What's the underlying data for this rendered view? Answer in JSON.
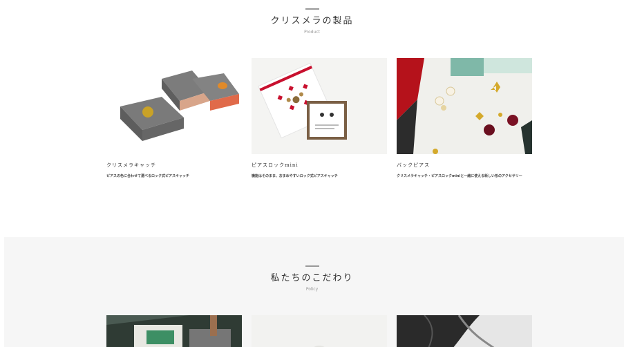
{
  "products": {
    "title": "クリスメラの製品",
    "subtitle": "Product",
    "items": [
      {
        "name": "クリスメラキャッチ",
        "desc": "ピアスの色に合わせて選べるロック式ピアスキャッチ"
      },
      {
        "name": "ピアスロックmini",
        "desc": "機能はそのまま、おまめやすいロック式ピアスキャッチ"
      },
      {
        "name": "バックピアス",
        "desc": "クリスメラキャッチ・ピアスロックminiと一緒に使える新しい形のアクセサリー"
      }
    ]
  },
  "policy": {
    "title": "私たちのこだわり",
    "subtitle": "Policy"
  },
  "colors": {
    "band": "#f6f6f6",
    "box_gray": "#6e6e6e",
    "gold": "#c9a227",
    "accent_red": "#c0392b"
  }
}
